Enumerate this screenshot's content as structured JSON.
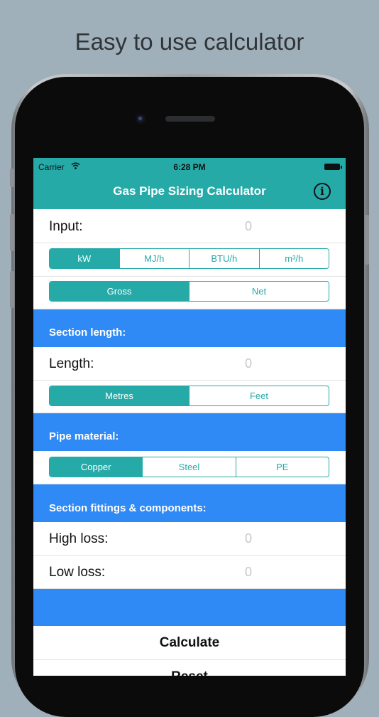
{
  "headline": "Easy to use calculator",
  "status_bar": {
    "carrier": "Carrier",
    "time": "6:28 PM"
  },
  "nav": {
    "title": "Gas Pipe Sizing Calculator",
    "info_icon": "info-icon"
  },
  "input_section": {
    "label": "Input:",
    "value": "0",
    "units": [
      "kW",
      "MJ/h",
      "BTU/h",
      "m³/h"
    ],
    "selected_unit": "kW",
    "value_type": [
      "Gross",
      "Net"
    ],
    "selected_value_type": "Gross"
  },
  "section_length": {
    "header": "Section length:",
    "label": "Length:",
    "value": "0",
    "units": [
      "Metres",
      "Feet"
    ],
    "selected_unit": "Metres"
  },
  "pipe_material": {
    "header": "Pipe material:",
    "options": [
      "Copper",
      "Steel",
      "PE"
    ],
    "selected": "Copper"
  },
  "fittings": {
    "header": "Section fittings & components:",
    "high_label": "High loss:",
    "high_value": "0",
    "low_label": "Low loss:",
    "low_value": "0"
  },
  "actions": {
    "calculate": "Calculate",
    "reset": "Reset"
  },
  "colors": {
    "teal": "#26aaa8",
    "blue": "#2f8af5",
    "background": "#9fb0ba"
  }
}
